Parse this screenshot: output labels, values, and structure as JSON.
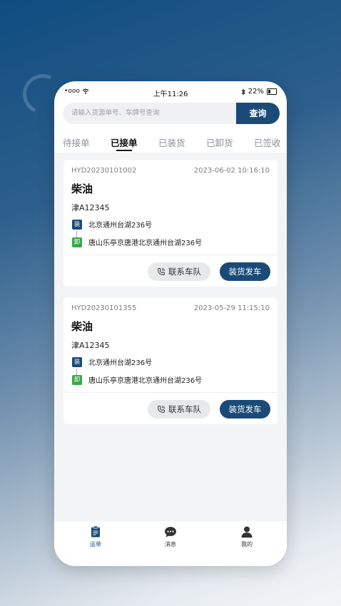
{
  "status_bar": {
    "signal": "•ooo",
    "time": "上午11:26",
    "battery": "22%"
  },
  "search": {
    "placeholder": "请输入货源单号、车牌号查询",
    "button_label": "查询"
  },
  "tabs": [
    {
      "label": "待接单",
      "active": false
    },
    {
      "label": "已接单",
      "active": true
    },
    {
      "label": "已装货",
      "active": false
    },
    {
      "label": "已卸货",
      "active": false
    },
    {
      "label": "已签收",
      "active": false
    }
  ],
  "orders": [
    {
      "id": "HYD20230101002",
      "time": "2023-06-02 10:16:10",
      "goods": "柴油",
      "plate": "津A12345",
      "load_badge": "装",
      "load_address": "北京通州台湖236号",
      "unload_badge": "卸",
      "unload_address": "唐山乐亭京唐港北京通州台湖236号",
      "contact_label": "联系车队",
      "action_label": "装货发车"
    },
    {
      "id": "HYD20230101355",
      "time": "2023-05-29 11:15:10",
      "goods": "柴油",
      "plate": "津A12345",
      "load_badge": "装",
      "load_address": "北京通州台湖236号",
      "unload_badge": "卸",
      "unload_address": "唐山乐亭京唐港北京通州台湖236号",
      "contact_label": "联系车队",
      "action_label": "装货发车"
    }
  ],
  "tabbar": [
    {
      "label": "运单",
      "icon": "waybill-icon",
      "active": true
    },
    {
      "label": "消息",
      "icon": "message-icon",
      "active": false
    },
    {
      "label": "我的",
      "icon": "profile-icon",
      "active": false
    }
  ],
  "colors": {
    "primary": "#1a4a78",
    "unload_green": "#3aa84a"
  }
}
